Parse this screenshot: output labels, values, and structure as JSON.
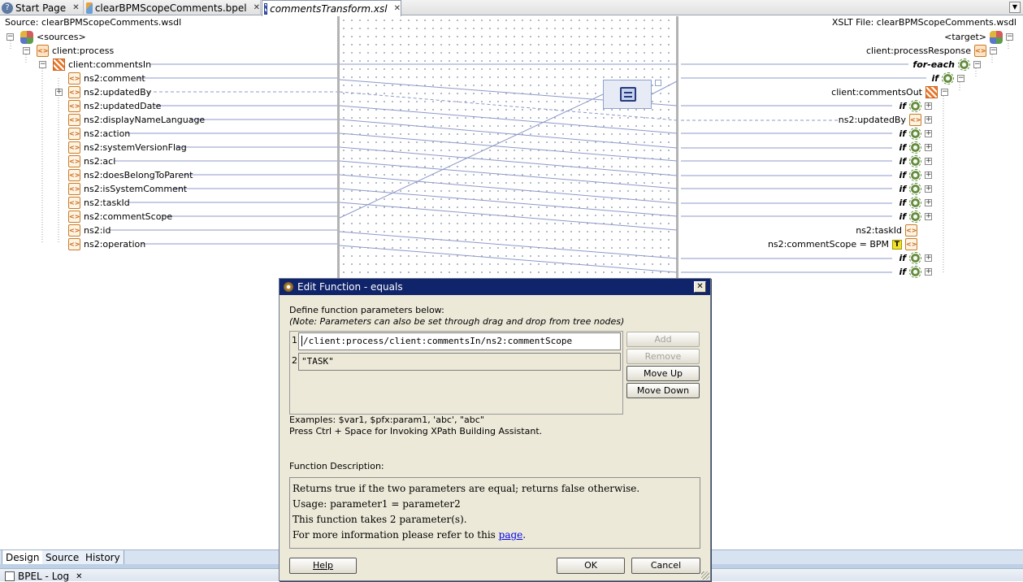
{
  "tabs": [
    {
      "label": "Start Page",
      "icon": "help-icon"
    },
    {
      "label": "clearBPMScopeComments.bpel",
      "icon": "bpel-icon"
    },
    {
      "label": "commentsTransform.xsl",
      "icon": "xsl-icon",
      "active": true
    }
  ],
  "source": {
    "header": "Source: clearBPMScopeComments.wsdl",
    "root": "<sources>",
    "process": "client:process",
    "comments_in": "client:commentsIn",
    "fields": [
      "ns2:comment",
      "ns2:updatedBy",
      "ns2:updatedDate",
      "ns2:displayNameLanguage",
      "ns2:action",
      "ns2:systemVersionFlag",
      "ns2:acl",
      "ns2:doesBelongToParent",
      "ns2:isSystemComment",
      "ns2:taskId",
      "ns2:commentScope",
      "ns2:id",
      "ns2:operation"
    ]
  },
  "target": {
    "header": "XSLT File: clearBPMScopeComments.wsdl",
    "root": "<target>",
    "process_response": "client:processResponse",
    "for_each": "for-each",
    "if_kw": "if",
    "comments_out": "client:commentsOut",
    "updated_by": "ns2:updatedBy",
    "task_id": "ns2:taskId",
    "comment_scope": "ns2:commentScope = BPM",
    "t_badge": "T"
  },
  "dialog": {
    "title": "Edit Function - equals",
    "intro": "Define function parameters below:",
    "note": "(Note: Parameters can also be set through drag and drop from tree nodes)",
    "params": [
      {
        "num": "1",
        "value": "/client:process/client:commentsIn/ns2:commentScope"
      },
      {
        "num": "2",
        "value": "\"TASK\""
      }
    ],
    "buttons": {
      "add": "Add",
      "remove": "Remove",
      "move_up": "Move Up",
      "move_down": "Move Down"
    },
    "examples": "Examples: $var1, $pfx:param1, 'abc', \"abc\"",
    "hint": "Press Ctrl + Space for Invoking XPath Building Assistant.",
    "desc_label": "Function Description:",
    "desc_lines": [
      "Returns true if the two parameters are equal; returns false otherwise.",
      "Usage: parameter1 = parameter2",
      "This function takes 2 parameter(s)."
    ],
    "desc_more": "For more information please refer to this",
    "desc_link": "page",
    "desc_end": ".",
    "help": "Help",
    "ok": "OK",
    "cancel": "Cancel"
  },
  "bottom_tabs": [
    "Design",
    "Source",
    "History"
  ],
  "log_tab": "BPEL - Log"
}
